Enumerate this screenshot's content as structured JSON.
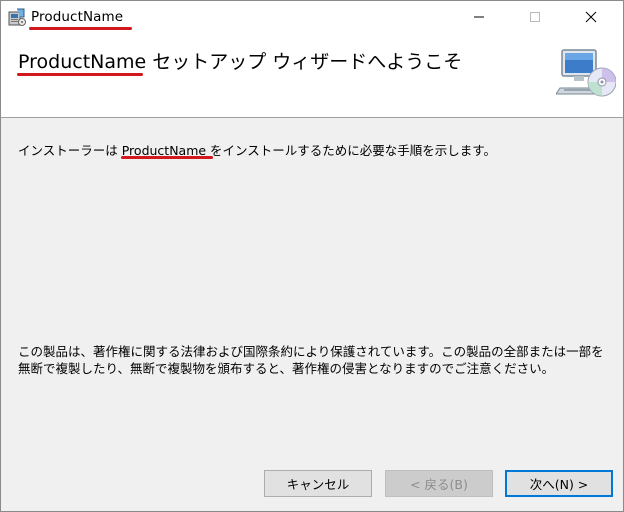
{
  "window": {
    "title": "ProductName",
    "caption_buttons": [
      "minimize-icon",
      "maximize-icon",
      "close-icon"
    ]
  },
  "header": {
    "title_product": "ProductName",
    "title_rest": " セットアップ ウィザードへようこそ",
    "image": "computer-cd-icon"
  },
  "body": {
    "intro_before": "インストーラーは ",
    "intro_product": "ProductName",
    "intro_after": " をインストールするために必要な手順を示します。",
    "copyright": "この製品は、著作権に関する法律および国際条約により保護されています。この製品の全部または一部を無断で複製したり、無断で複製物を頒布すると、著作権の侵害となりますのでご注意ください。"
  },
  "buttons": {
    "cancel": "キャンセル",
    "back": "< 戻る(B)",
    "next": "次へ(N) >"
  },
  "colors": {
    "annotation_underline": "#d0181e",
    "default_button_border": "#0078d7",
    "dialog_bg": "#f0f0f0"
  }
}
